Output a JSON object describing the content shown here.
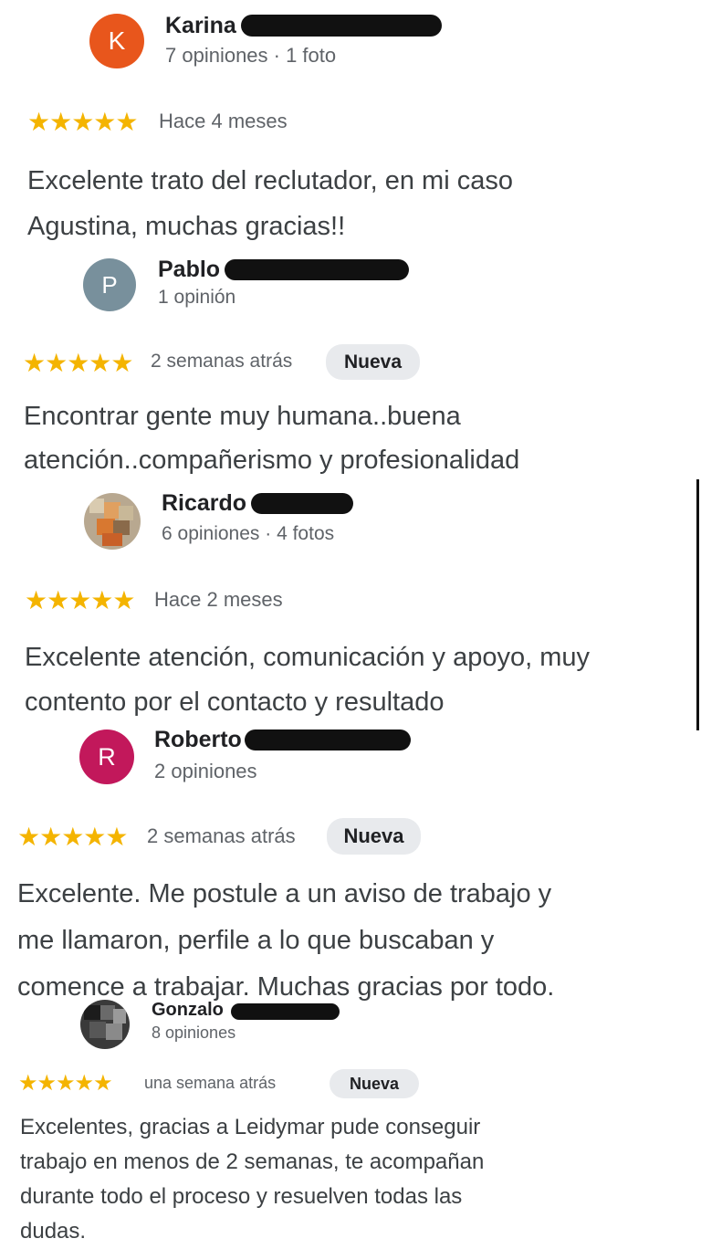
{
  "reviews": [
    {
      "avatar_letter": "K",
      "avatar_color": "#e8561c",
      "name": "Karina",
      "meta": "7 opiniones · 1 foto",
      "stars": "★★★★★",
      "date": "Hace 4 meses",
      "badge": "",
      "text_lines": [
        "Excelente trato del reclutador, en mi caso",
        "Agustina, muchas gracias!!"
      ]
    },
    {
      "avatar_letter": "P",
      "avatar_color": "#78909c",
      "name": "Pablo",
      "meta": "1 opinión",
      "stars": "★★★★★",
      "date": "2 semanas atrás",
      "badge": "Nueva",
      "text_lines": [
        "Encontrar gente muy humana..buena",
        "atención..compañerismo y profesionalidad"
      ]
    },
    {
      "avatar_letter": "",
      "avatar_color": "",
      "name": "Ricardo",
      "meta": "6 opiniones · 4 fotos",
      "stars": "★★★★★",
      "date": "Hace 2 meses",
      "badge": "",
      "text_lines": [
        "Excelente atención, comunicación y apoyo, muy",
        "contento por el contacto y resultado"
      ]
    },
    {
      "avatar_letter": "R",
      "avatar_color": "#c2185b",
      "name": "Roberto",
      "meta": "2 opiniones",
      "stars": "★★★★★",
      "date": "2 semanas atrás",
      "badge": "Nueva",
      "text_lines": [
        "Excelente. Me postule a un aviso de trabajo y",
        "me llamaron, perfile a lo que buscaban y",
        "comence a trabajar. Muchas gracias por todo."
      ]
    },
    {
      "avatar_letter": "",
      "avatar_color": "",
      "name": "Gonzalo",
      "meta": "8 opiniones",
      "stars": "★★★★★",
      "date": "una semana atrás",
      "badge": "Nueva",
      "text_lines": [
        "Excelentes, gracias a Leidymar pude conseguir",
        "trabajo en menos de 2 semanas, te acompañan",
        "durante todo el proceso y resuelven todas las",
        "dudas."
      ]
    }
  ]
}
